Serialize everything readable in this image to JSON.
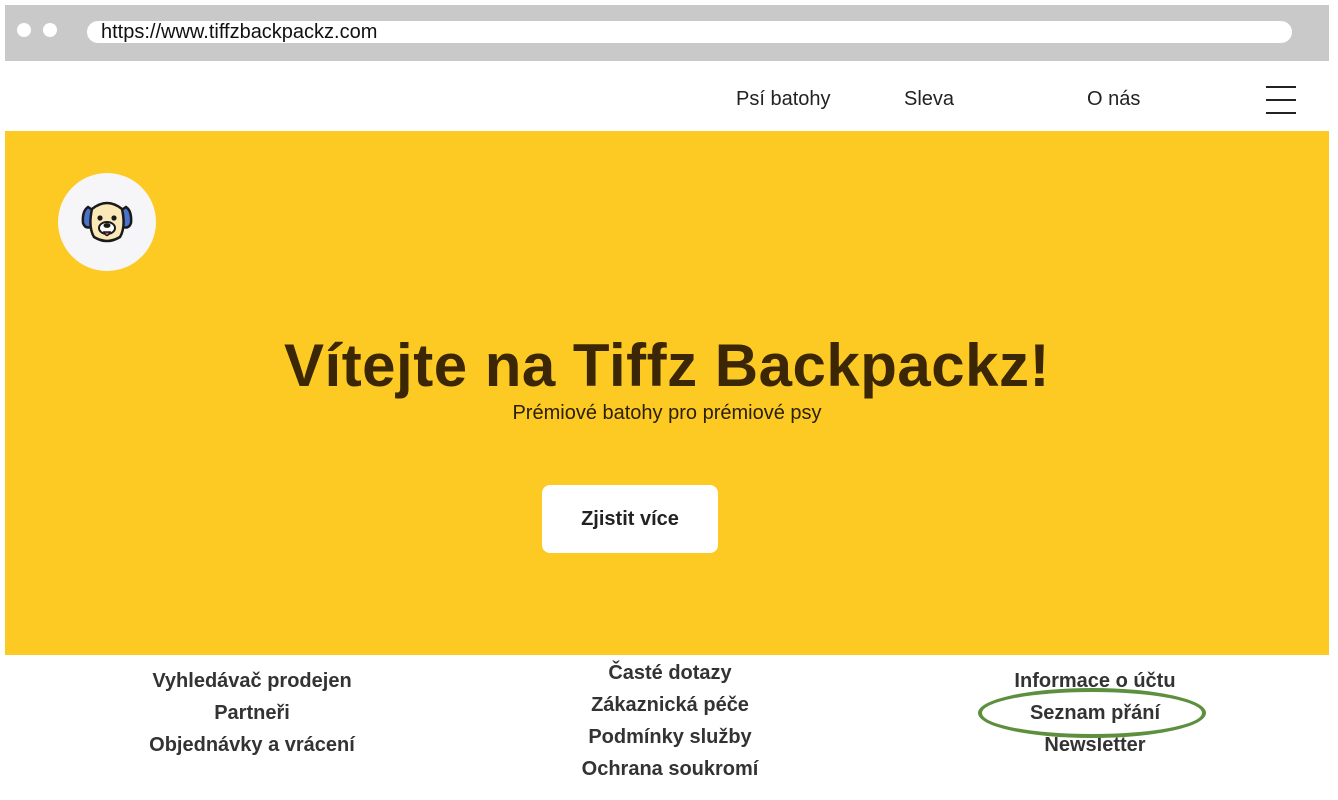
{
  "browser": {
    "url": "https://www.tiffzbackpackz.com"
  },
  "nav": {
    "links": [
      "Psí batohy",
      "Sleva",
      "O nás"
    ],
    "menu_icon": "hamburger-menu-icon"
  },
  "hero": {
    "logo_icon": "dog-face-icon",
    "title": "Vítejte na Tiffz Backpackz!",
    "subtitle": "Prémiové batohy pro prémiové psy",
    "cta_label": "Zjistit více",
    "background_color": "#fcca23"
  },
  "footer": {
    "column1": [
      "Vyhledávač prodejen",
      "Partneři",
      "Objednávky a vrácení"
    ],
    "column2": [
      "Časté dotazy",
      "Zákaznická péče",
      "Podmínky služby",
      "Ochrana soukromí"
    ],
    "column3": [
      "Informace o účtu",
      "Seznam přání",
      "Newsletter"
    ],
    "highlighted_item": "Seznam přání",
    "highlight_color": "#5c8f3e"
  }
}
